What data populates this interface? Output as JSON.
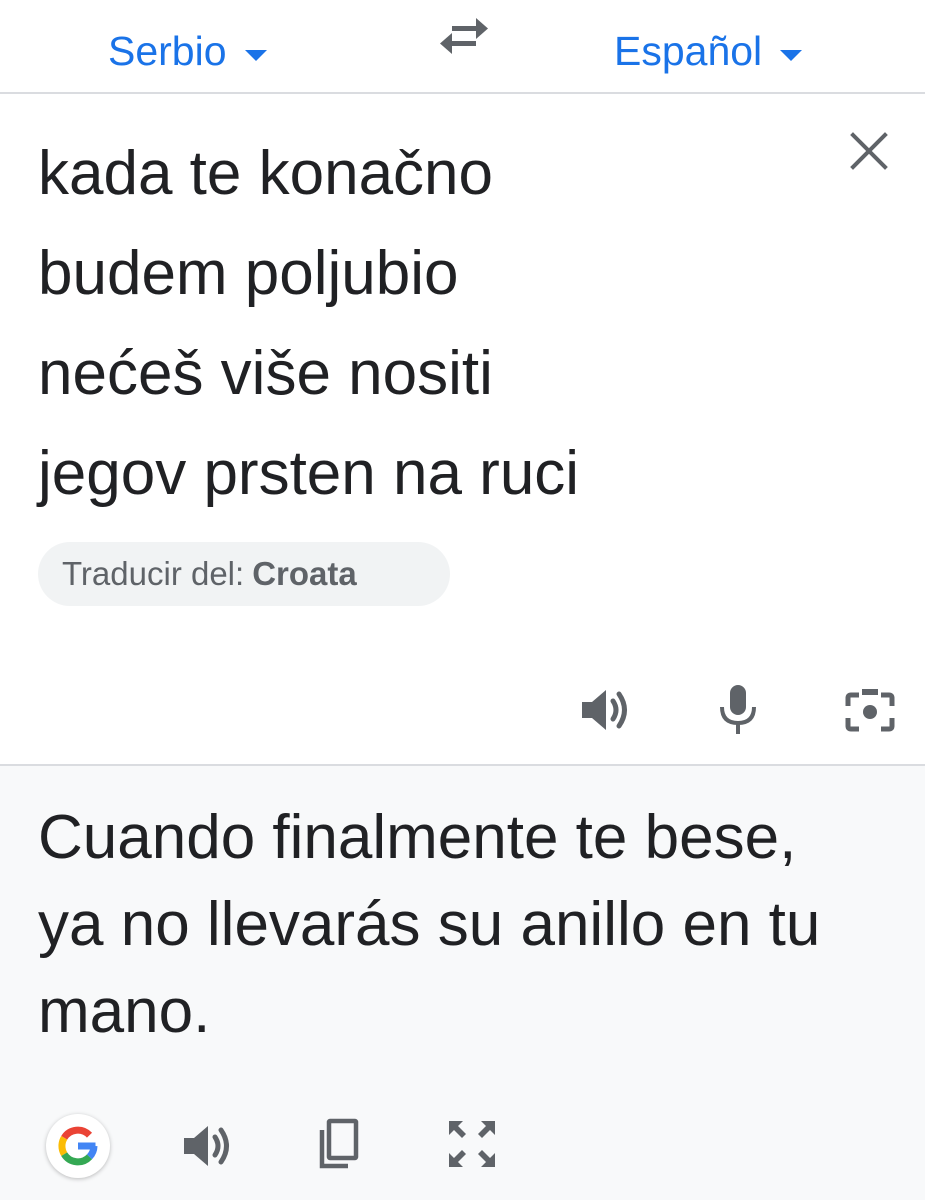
{
  "language_bar": {
    "source_language": "Serbio",
    "target_language": "Español",
    "swap_icon": "swap-arrows-icon"
  },
  "source": {
    "text": "kada te konačno\nbudem poljubio\nnećeš više nositi\njegov prsten na ruci",
    "clear_icon": "close-icon",
    "detect_label": "Traducir del:",
    "detect_language": "Croata",
    "tools": [
      "speaker-icon",
      "microphone-icon",
      "camera-icon"
    ]
  },
  "target": {
    "text": "Cuando finalmente te bese, ya no llevarás su anillo en tu mano.",
    "tools": [
      "google-logo-icon",
      "speaker-icon",
      "copy-icon",
      "fullscreen-icon"
    ]
  },
  "colors": {
    "accent": "#1a73e8",
    "text": "#202124",
    "icon": "#5f6368",
    "target_background": "#f8f9fa",
    "divider": "#dadce0"
  }
}
